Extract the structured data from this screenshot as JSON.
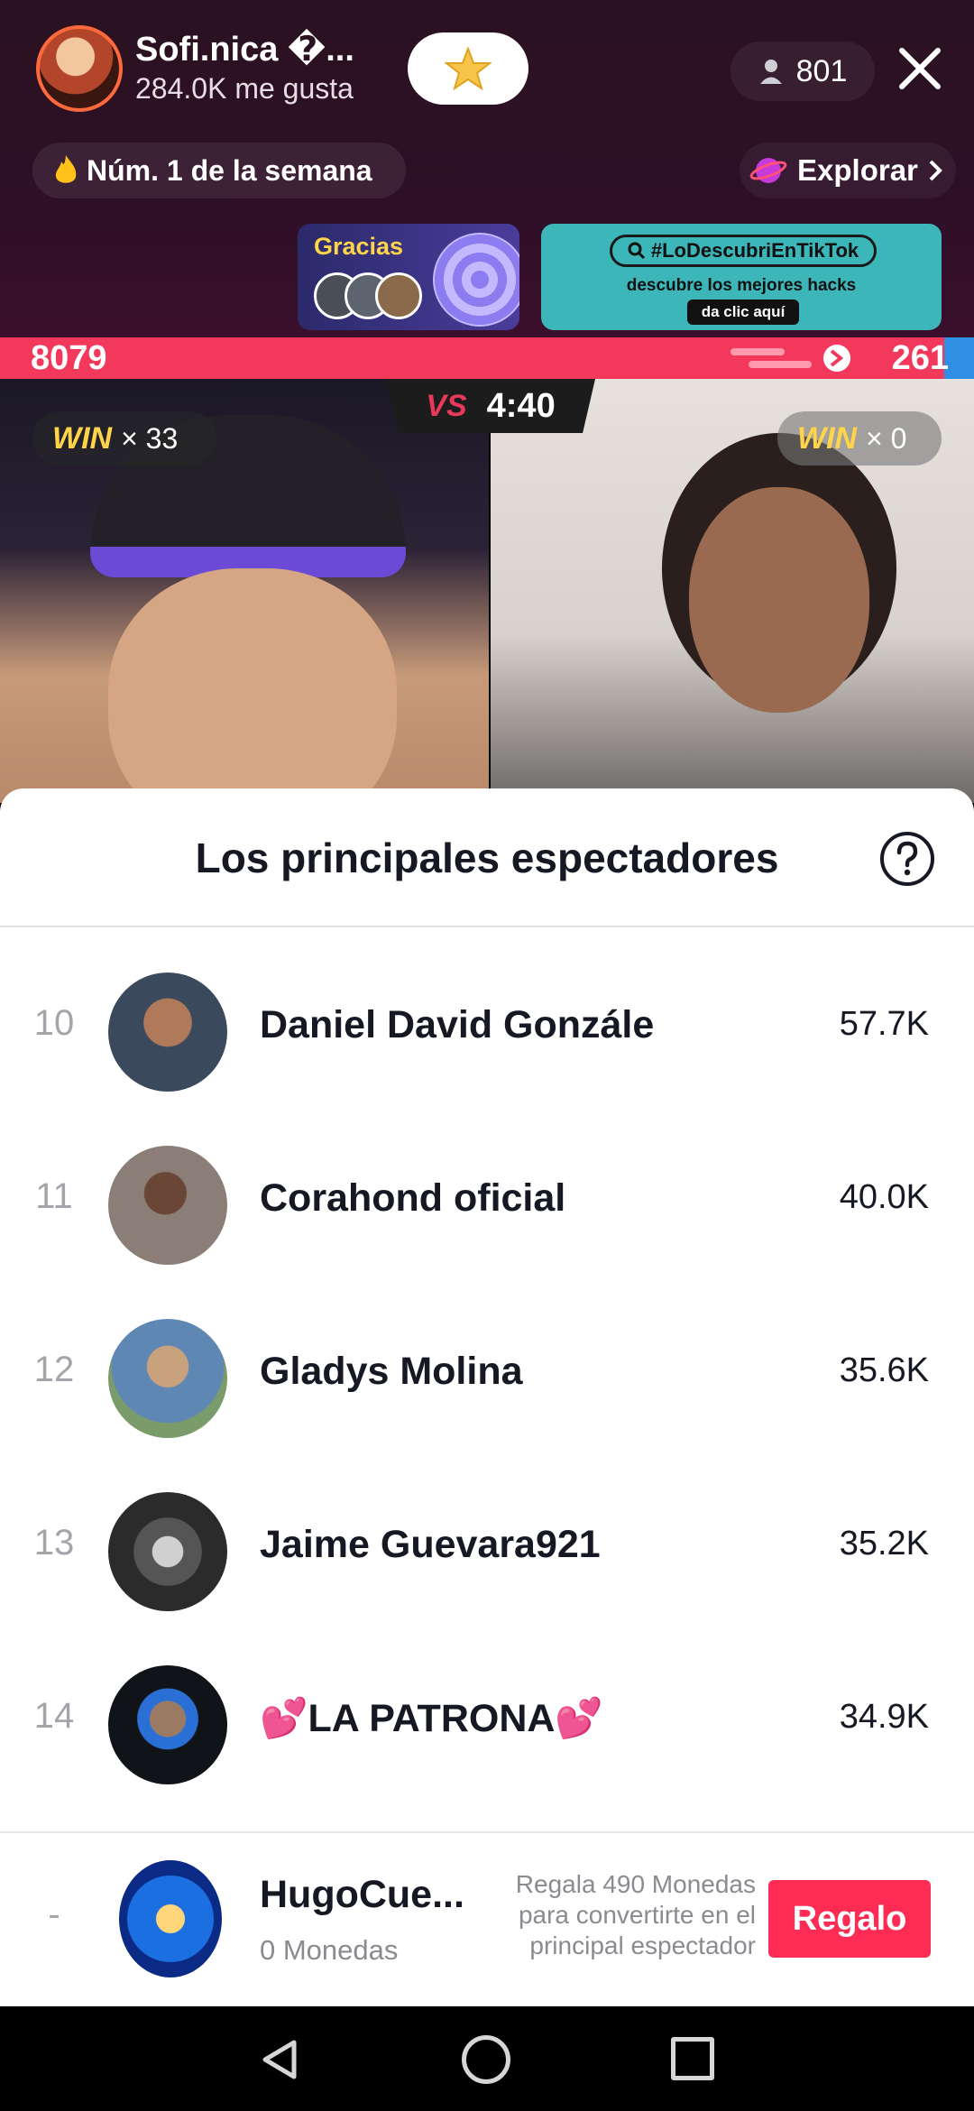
{
  "host": {
    "name": "Sofi.nica �...",
    "likes": "284.0K me gusta",
    "viewers": "801"
  },
  "rank_chip": {
    "icon": "fire-icon",
    "label": "Núm. 1 de la semana"
  },
  "explore": {
    "label": "Explorar"
  },
  "gracias": {
    "label": "Gracias"
  },
  "promo": {
    "hashtag": "#LoDescubriEnTikTok",
    "subtitle": "descubre los mejores hacks",
    "cta": "da clic aquí"
  },
  "battle": {
    "left_score": "8079",
    "right_score": "261",
    "left_share": 0.969,
    "timer": "4:40",
    "vs_label": "VS",
    "left_wins_word": "WIN",
    "left_wins": "× 33",
    "right_wins_word": "WIN",
    "right_wins": "× 0"
  },
  "sheet": {
    "title": "Los principales espectadores",
    "rows": [
      {
        "rank": "10",
        "name": "Daniel David Gonzále",
        "coins": "57.7K",
        "avatar_color": "#3a4a5c"
      },
      {
        "rank": "11",
        "name": "Corahond oficial",
        "coins": "40.0K",
        "avatar_color": "#8a7e76"
      },
      {
        "rank": "12",
        "name": "Gladys Molina",
        "coins": "35.6K",
        "avatar_color": "#5f87b4"
      },
      {
        "rank": "13",
        "name": "Jaime Guevara921",
        "coins": "35.2K",
        "avatar_color": "#2b2b2b"
      },
      {
        "rank": "14",
        "name": "💕LA PATRONA💕",
        "coins": "34.9K",
        "avatar_color": "#101418"
      }
    ]
  },
  "me": {
    "rank": "-",
    "name": "HugoCue...",
    "coins": "0 Monedas",
    "message": "Regala 490 Monedas para convertirte en el principal espectador",
    "gift_button": "Regalo"
  },
  "colors": {
    "accent_red": "#fe2c55",
    "battle_red": "#f2395b",
    "battle_blue": "#2f8fe3"
  }
}
